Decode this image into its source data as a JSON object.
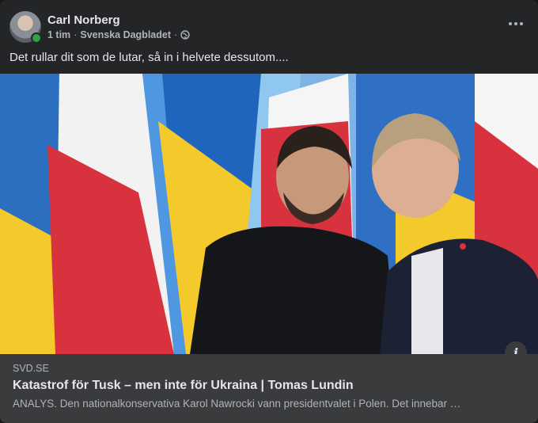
{
  "post": {
    "author": "Carl Norberg",
    "time": "1 tim",
    "source": "Svenska Dagbladet",
    "separator": "·",
    "text": "Det rullar dit som de lutar, så in i helvete dessutom....",
    "icons": [
      "more-options-icon",
      "globe-icon",
      "info-icon"
    ],
    "colors": {
      "background": "#242526",
      "link_bg": "#3a3b3c",
      "online": "#31a24c"
    }
  },
  "link_preview": {
    "domain": "SVD.SE",
    "title": "Katastrof för Tusk – men inte för Ukraina | Tomas Lundin",
    "description": "ANALYS. Den nationalkonservativa Karol Nawrocki vann presidentvalet i Polen. Det innebar …",
    "info_glyph": "i"
  }
}
